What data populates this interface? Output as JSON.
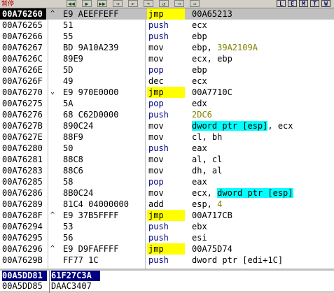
{
  "toolbar": {
    "title": "暂停",
    "buttons": [
      "◀◀",
      "▶",
      "▶▶",
      "⇥",
      "⇤",
      "↷",
      "↺",
      "→",
      "⇒"
    ],
    "letters": [
      "L",
      "E",
      "M",
      "T",
      "W"
    ]
  },
  "rows": [
    {
      "addr": "00A76260",
      "mark": "^",
      "hex": "E9 AEEFFEFF",
      "mn": "jmp",
      "kind": "jmp",
      "op": [
        {
          "t": "00A65213"
        }
      ],
      "selected": true
    },
    {
      "addr": "00A76265",
      "mark": "",
      "hex": "51",
      "mn": "push",
      "kind": "push",
      "op": [
        {
          "t": "ecx"
        }
      ]
    },
    {
      "addr": "00A76266",
      "mark": "",
      "hex": "55",
      "mn": "push",
      "kind": "push",
      "op": [
        {
          "t": "ebp"
        }
      ]
    },
    {
      "addr": "00A76267",
      "mark": "",
      "hex": "BD 9A10A239",
      "mn": "mov",
      "kind": "mov",
      "op": [
        {
          "t": "ebp, "
        },
        {
          "t": "39A2109A",
          "c": "imm"
        }
      ]
    },
    {
      "addr": "00A7626C",
      "mark": "",
      "hex": "89E9",
      "mn": "mov",
      "kind": "mov",
      "op": [
        {
          "t": "ecx, ebp"
        }
      ]
    },
    {
      "addr": "00A7626E",
      "mark": "",
      "hex": "5D",
      "mn": "pop",
      "kind": "pop",
      "op": [
        {
          "t": "ebp"
        }
      ]
    },
    {
      "addr": "00A7626F",
      "mark": "",
      "hex": "49",
      "mn": "dec",
      "kind": "mov",
      "op": [
        {
          "t": "ecx"
        }
      ]
    },
    {
      "addr": "00A76270",
      "mark": "v",
      "hex": "E9 970E0000",
      "mn": "jmp",
      "kind": "jmp",
      "op": [
        {
          "t": "00A7710C"
        }
      ]
    },
    {
      "addr": "00A76275",
      "mark": "",
      "hex": "5A",
      "mn": "pop",
      "kind": "pop",
      "op": [
        {
          "t": "edx"
        }
      ]
    },
    {
      "addr": "00A76276",
      "mark": "",
      "hex": "68 C62D0000",
      "mn": "push",
      "kind": "push",
      "op": [
        {
          "t": "2DC6",
          "c": "imm"
        }
      ]
    },
    {
      "addr": "00A7627B",
      "mark": "",
      "hex": "890C24",
      "mn": "mov",
      "kind": "mov",
      "op": [
        {
          "t": "dword ptr [esp]",
          "c": "mem"
        },
        {
          "t": ", ecx"
        }
      ]
    },
    {
      "addr": "00A7627E",
      "mark": "",
      "hex": "88F9",
      "mn": "mov",
      "kind": "mov",
      "op": [
        {
          "t": "cl, bh"
        }
      ]
    },
    {
      "addr": "00A76280",
      "mark": "",
      "hex": "50",
      "mn": "push",
      "kind": "push",
      "op": [
        {
          "t": "eax"
        }
      ]
    },
    {
      "addr": "00A76281",
      "mark": "",
      "hex": "88C8",
      "mn": "mov",
      "kind": "mov",
      "op": [
        {
          "t": "al, cl"
        }
      ]
    },
    {
      "addr": "00A76283",
      "mark": "",
      "hex": "88C6",
      "mn": "mov",
      "kind": "mov",
      "op": [
        {
          "t": "dh, al"
        }
      ]
    },
    {
      "addr": "00A76285",
      "mark": "",
      "hex": "58",
      "mn": "pop",
      "kind": "pop",
      "op": [
        {
          "t": "eax"
        }
      ]
    },
    {
      "addr": "00A76286",
      "mark": "",
      "hex": "8B0C24",
      "mn": "mov",
      "kind": "mov",
      "op": [
        {
          "t": "ecx, "
        },
        {
          "t": "dword ptr [esp]",
          "c": "mem"
        }
      ]
    },
    {
      "addr": "00A76289",
      "mark": "",
      "hex": "81C4 04000000",
      "mn": "add",
      "kind": "mov",
      "op": [
        {
          "t": "esp, "
        },
        {
          "t": "4",
          "c": "imm"
        }
      ]
    },
    {
      "addr": "00A7628F",
      "mark": "^",
      "hex": "E9 37B5FFFF",
      "mn": "jmp",
      "kind": "jmp",
      "op": [
        {
          "t": "00A717CB"
        }
      ]
    },
    {
      "addr": "00A76294",
      "mark": "",
      "hex": "53",
      "mn": "push",
      "kind": "push",
      "op": [
        {
          "t": "ebx"
        }
      ]
    },
    {
      "addr": "00A76295",
      "mark": "",
      "hex": "56",
      "mn": "push",
      "kind": "push",
      "op": [
        {
          "t": "esi"
        }
      ]
    },
    {
      "addr": "00A76296",
      "mark": "^",
      "hex": "E9 D9FAFFFF",
      "mn": "jmp",
      "kind": "jmp",
      "op": [
        {
          "t": "00A75D74"
        }
      ]
    },
    {
      "addr": "00A7629B",
      "mark": "",
      "hex": "FF77 1C",
      "mn": "push",
      "kind": "push",
      "op": [
        {
          "t": "dword ptr [edi+1C]"
        }
      ]
    }
  ],
  "dump": [
    {
      "addr": "00A5DD81",
      "val": "61F27C3A",
      "selected": true
    },
    {
      "addr": "00A5DD85",
      "val": "DAAC3407",
      "selected": false
    }
  ]
}
